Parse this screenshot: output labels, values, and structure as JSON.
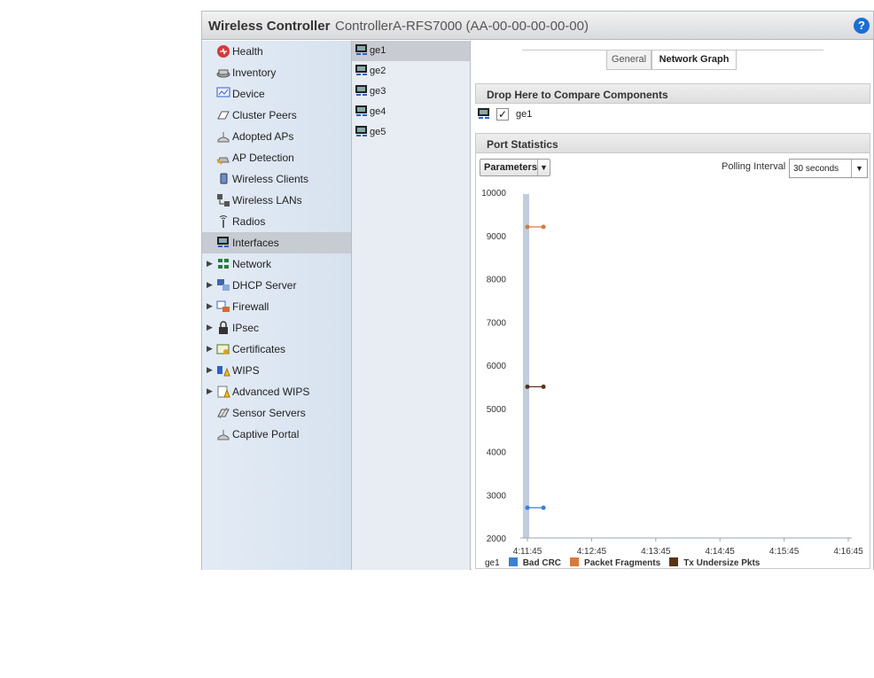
{
  "header": {
    "title": "Wireless Controller",
    "controller": "ControllerA-RFS7000 (AA-00-00-00-00-00)",
    "help": "?"
  },
  "sidebar": {
    "items": [
      {
        "label": "Health",
        "icon": "health-icon"
      },
      {
        "label": "Inventory",
        "icon": "inventory-icon"
      },
      {
        "label": "Device",
        "icon": "device-icon"
      },
      {
        "label": "Cluster Peers",
        "icon": "cluster-peers-icon"
      },
      {
        "label": "Adopted APs",
        "icon": "adopted-aps-icon"
      },
      {
        "label": "AP Detection",
        "icon": "ap-detection-icon"
      },
      {
        "label": "Wireless Clients",
        "icon": "wireless-clients-icon"
      },
      {
        "label": "Wireless LANs",
        "icon": "wireless-lans-icon"
      },
      {
        "label": "Radios",
        "icon": "radios-icon"
      },
      {
        "label": "Interfaces",
        "icon": "interfaces-icon",
        "selected": true
      },
      {
        "label": "Network",
        "icon": "network-icon",
        "expandable": true
      },
      {
        "label": "DHCP Server",
        "icon": "dhcp-server-icon",
        "expandable": true
      },
      {
        "label": "Firewall",
        "icon": "firewall-icon",
        "expandable": true
      },
      {
        "label": "IPsec",
        "icon": "ipsec-icon",
        "expandable": true
      },
      {
        "label": "Certificates",
        "icon": "certificates-icon",
        "expandable": true
      },
      {
        "label": "WIPS",
        "icon": "wips-icon",
        "expandable": true
      },
      {
        "label": "Advanced WIPS",
        "icon": "advanced-wips-icon",
        "expandable": true
      },
      {
        "label": "Sensor Servers",
        "icon": "sensor-servers-icon"
      },
      {
        "label": "Captive Portal",
        "icon": "captive-portal-icon"
      }
    ]
  },
  "interfaces": {
    "items": [
      {
        "label": "ge1",
        "selected": true
      },
      {
        "label": "ge2"
      },
      {
        "label": "ge3"
      },
      {
        "label": "ge4"
      },
      {
        "label": "ge5"
      }
    ]
  },
  "tabs": [
    {
      "label": "General",
      "active": false
    },
    {
      "label": "Network Graph",
      "active": true
    }
  ],
  "compare": {
    "header": "Drop Here to Compare Components",
    "checked": "✓",
    "item": "ge1"
  },
  "stats": {
    "header": "Port Statistics",
    "parameters_label": "Parameters",
    "polling_label": "Polling Interval",
    "polling_value": "30 seconds"
  },
  "colors": {
    "bad_crc": "#3a7fd5",
    "packet_fragments": "#d8793a",
    "tx_undersize": "#5b3214"
  },
  "chart_data": {
    "type": "line",
    "x": [
      "4:11:45",
      "4:12:00"
    ],
    "xticks": [
      "4:11:45",
      "4:12:45",
      "4:13:45",
      "4:14:45",
      "4:15:45",
      "4:16:45"
    ],
    "ylim": [
      2000,
      10000
    ],
    "yticks": [
      2000,
      3000,
      4000,
      5000,
      6000,
      7000,
      8000,
      9000,
      10000
    ],
    "legend_prefix": "ge1",
    "series": [
      {
        "name": "Bad CRC",
        "values": [
          2700,
          2700
        ],
        "color": "#3a7fd5"
      },
      {
        "name": "Packet Fragments",
        "values": [
          9200,
          9200
        ],
        "color": "#d8793a"
      },
      {
        "name": "Tx Undersize Pkts",
        "values": [
          5500,
          5500
        ],
        "color": "#5b3214"
      }
    ]
  }
}
